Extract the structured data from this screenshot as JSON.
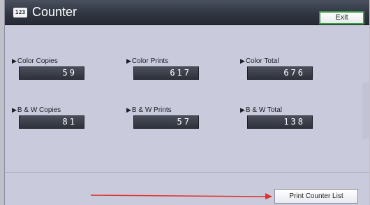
{
  "header": {
    "app_icon_text": "123",
    "title": "Counter",
    "exit_label": "Exit"
  },
  "counters": [
    {
      "label": "Color Copies",
      "value": "59"
    },
    {
      "label": "Color Prints",
      "value": "617"
    },
    {
      "label": "Color Total",
      "value": "676"
    },
    {
      "label": "B & W Copies",
      "value": "81"
    },
    {
      "label": "B & W Prints",
      "value": "57"
    },
    {
      "label": "B & W Total",
      "value": "138"
    }
  ],
  "footer": {
    "print_counter_list_label": "Print Counter List"
  },
  "colors": {
    "titlebar": "#2f3440",
    "background": "#c9cadb",
    "exit_border": "#3c9a4a",
    "annotation_arrow": "#e0302a"
  },
  "icons": {
    "label_marker": "triangle-right-icon",
    "annotation": "arrow-right-icon"
  }
}
